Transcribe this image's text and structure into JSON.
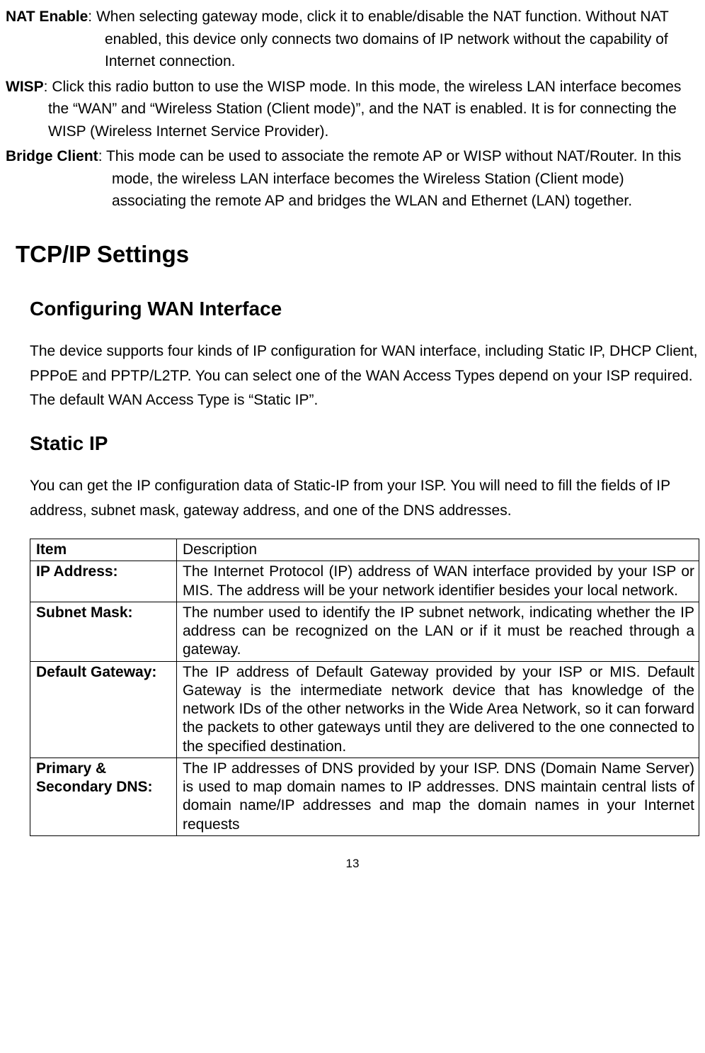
{
  "defs": {
    "nat": {
      "label": "NAT Enable",
      "text": ": When selecting gateway mode, click it to enable/disable the NAT function. Without NAT enabled, this device only connects two domains of IP network without the capability of Internet connection."
    },
    "wisp": {
      "label": "WISP",
      "text": ": Click this radio button to use the WISP mode. In this mode, the wireless LAN interface becomes the “WAN” and “Wireless Station (Client mode)”, and the NAT is enabled. It is for connecting the WISP (Wireless Internet Service Provider)."
    },
    "bridge": {
      "label": "Bridge Client",
      "text": ": This mode can be used to associate the remote AP or WISP without NAT/Router. In this mode, the wireless LAN interface becomes the Wireless Station (Client mode) associating the remote AP and bridges the WLAN and Ethernet (LAN) together."
    }
  },
  "headings": {
    "tcpip": "TCP/IP Settings",
    "wan": "Configuring WAN Interface",
    "staticip": "Static IP"
  },
  "paras": {
    "wan": "The device supports four kinds of IP configuration for WAN interface, including Static IP, DHCP Client, PPPoE and PPTP/L2TP. You can select one of the WAN Access Types depend on your ISP required. The default WAN Access Type is “Static IP”.",
    "staticip": "You can get the IP configuration data of Static-IP from your ISP. You will need to fill the fields of IP address, subnet mask, gateway address, and one of the DNS addresses."
  },
  "table": {
    "header": {
      "item": "Item",
      "desc": "Description"
    },
    "rows": [
      {
        "item": "IP Address:",
        "desc": "The Internet Protocol (IP) address of WAN interface provided by your ISP or MIS. The address will be your network identifier besides your local network."
      },
      {
        "item": "Subnet Mask:",
        "desc": "The number used to identify the IP subnet network, indicating whether the IP address can be recognized on the LAN or if it must be reached through a gateway."
      },
      {
        "item": "Default Gateway:",
        "desc": "The IP address of Default Gateway provided by your ISP or MIS. Default Gateway is the intermediate network device that has knowledge of the network IDs of the other networks in the Wide Area Network, so it can forward the packets to other gateways until they are delivered to the one connected to the specified destination."
      },
      {
        "item": "Primary & Secondary DNS:",
        "desc": "The IP addresses of DNS provided by your ISP.\nDNS (Domain Name Server) is used to map domain names to IP addresses. DNS maintain central lists of domain name/IP addresses and map the domain names in your Internet requests"
      }
    ]
  },
  "page_number": "13"
}
